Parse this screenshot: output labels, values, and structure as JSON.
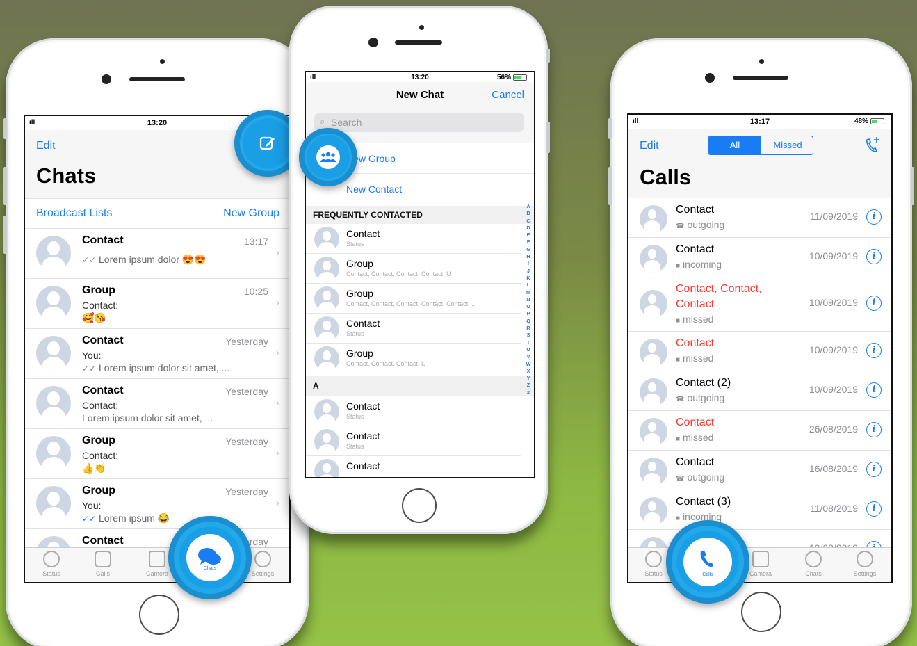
{
  "chats_screen": {
    "status_time": "13:20",
    "edit": "Edit",
    "title": "Chats",
    "broadcast": "Broadcast Lists",
    "new_group": "New Group",
    "rows": [
      {
        "name": "Contact",
        "time": "13:17",
        "l2": "Lorem ipsum dolor 😍😍",
        "l3": ""
      },
      {
        "name": "Group",
        "time": "10:25",
        "l2": "Contact:",
        "l3": "🥰😘"
      },
      {
        "name": "Contact",
        "time": "Yesterday",
        "l2": "You:",
        "l3": "Lorem ipsum dolor sit amet, ..."
      },
      {
        "name": "Contact",
        "time": "Yesterday",
        "l2": "Contact:",
        "l3": "Lorem ipsum dolor sit amet, ..."
      },
      {
        "name": "Group",
        "time": "Yesterday",
        "l2": "Contact:",
        "l3": "👍👏"
      },
      {
        "name": "Group",
        "time": "Yesterday",
        "l2": "You:",
        "l3": "Lorem ipsum 😂"
      },
      {
        "name": "Contact",
        "time": "Yesterday",
        "l2": "",
        "l3": ""
      }
    ],
    "tabs": [
      "Status",
      "Calls",
      "Camera",
      "Chats",
      "Settings"
    ]
  },
  "new_chat_screen": {
    "status_time": "13:20",
    "battery": "56%",
    "title": "New Chat",
    "cancel": "Cancel",
    "search_placeholder": "Search",
    "new_group": "New Group",
    "new_contact": "New Contact",
    "section_frequent": "FREQUENTLY CONTACTED",
    "section_a": "A",
    "frequent": [
      {
        "name": "Contact",
        "sub": "Status"
      },
      {
        "name": "Group",
        "sub": "Contact, Contact, Contact, Contact, U"
      },
      {
        "name": "Group",
        "sub": "Contact, Contact, Contact, Contact, Contact, ..."
      },
      {
        "name": "Contact",
        "sub": "Status"
      },
      {
        "name": "Group",
        "sub": "Contact, Contact, Contact, U"
      }
    ],
    "a_list": [
      {
        "name": "Contact",
        "sub": "Status"
      },
      {
        "name": "Contact",
        "sub": "Status"
      },
      {
        "name": "Contact",
        "sub": ""
      }
    ],
    "alphabet": [
      "A",
      "B",
      "C",
      "D",
      "E",
      "F",
      "G",
      "H",
      "I",
      "J",
      "K",
      "L",
      "M",
      "N",
      "O",
      "P",
      "Q",
      "R",
      "S",
      "T",
      "U",
      "V",
      "W",
      "X",
      "Y",
      "Z",
      "#"
    ]
  },
  "calls_screen": {
    "status_time": "13:17",
    "battery": "48%",
    "edit": "Edit",
    "seg_all": "All",
    "seg_missed": "Missed",
    "title": "Calls",
    "rows": [
      {
        "name": "Contact",
        "kind": "outgoing",
        "date": "11/09/2019",
        "missed": false
      },
      {
        "name": "Contact",
        "kind": "incoming",
        "date": "10/09/2019",
        "missed": false
      },
      {
        "name": "Contact, Contact,\nContact",
        "kind": "missed",
        "date": "10/09/2019",
        "missed": true
      },
      {
        "name": "Contact",
        "kind": "missed",
        "date": "10/09/2019",
        "missed": true
      },
      {
        "name": "Contact (2)",
        "kind": "outgoing",
        "date": "10/09/2019",
        "missed": false
      },
      {
        "name": "Contact",
        "kind": "missed",
        "date": "26/08/2019",
        "missed": true
      },
      {
        "name": "Contact",
        "kind": "outgoing",
        "date": "16/08/2019",
        "missed": false
      },
      {
        "name": "Contact (3)",
        "kind": "incoming",
        "date": "11/08/2019",
        "missed": false
      },
      {
        "name": "",
        "kind": "",
        "date": "10/08/2019",
        "missed": false
      }
    ],
    "tabs": [
      "Status",
      "Calls",
      "Camera",
      "Chats",
      "Settings"
    ]
  },
  "colors": {
    "accent": "#1a7cf5",
    "missed": "#ff3b30",
    "callout": "#1a9ee6"
  }
}
